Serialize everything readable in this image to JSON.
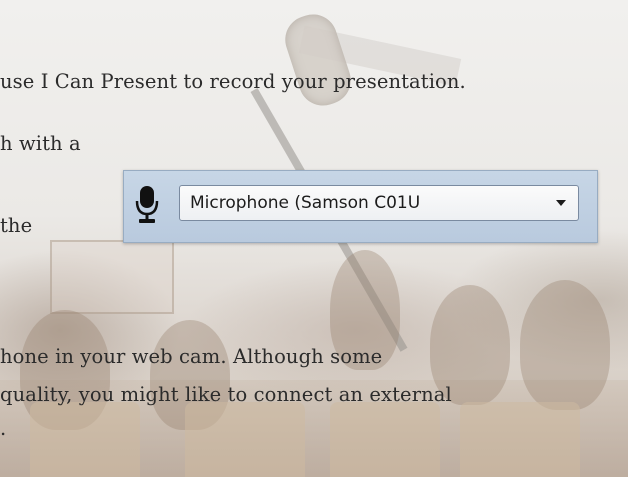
{
  "body_text": {
    "lines": [
      "use I Can Present to record your presentation.",
      "h with a",
      "the",
      "hone in your web cam. Although some",
      "quality, you might like to connect an external",
      "."
    ]
  },
  "microphone_panel": {
    "icon": "microphone-icon",
    "selected_device": "Microphone (Samson C01U",
    "dropdown_icon": "chevron-down-icon"
  },
  "colors": {
    "panel_bg": "#c7d6e6",
    "text": "#2b2b2b"
  }
}
